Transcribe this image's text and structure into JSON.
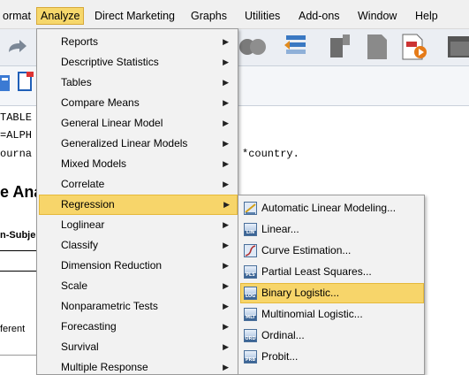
{
  "menubar": {
    "items": [
      "ormat",
      "Analyze",
      "Direct Marketing",
      "Graphs",
      "Utilities",
      "Add-ons",
      "Window",
      "Help"
    ],
    "active": "Analyze"
  },
  "syntax": {
    "line1": "TABLE",
    "line2": "=ALPH",
    "line3": "ourna",
    "line3_right": "*country.",
    "heading": "e Ana",
    "subheading": "n-Subje",
    "row_label": "ferent"
  },
  "analyze_menu": {
    "items": [
      {
        "label": "Reports"
      },
      {
        "label": "Descriptive Statistics"
      },
      {
        "label": "Tables"
      },
      {
        "label": "Compare Means"
      },
      {
        "label": "General Linear Model"
      },
      {
        "label": "Generalized Linear Models"
      },
      {
        "label": "Mixed Models"
      },
      {
        "label": "Correlate"
      },
      {
        "label": "Regression"
      },
      {
        "label": "Loglinear"
      },
      {
        "label": "Classify"
      },
      {
        "label": "Dimension Reduction"
      },
      {
        "label": "Scale"
      },
      {
        "label": "Nonparametric Tests"
      },
      {
        "label": "Forecasting"
      },
      {
        "label": "Survival"
      },
      {
        "label": "Multiple Response"
      }
    ],
    "highlighted": "Regression"
  },
  "regression_submenu": {
    "items": [
      {
        "label": "Automatic Linear Modeling...",
        "icon": "auto-linear-icon",
        "badge": ""
      },
      {
        "label": "Linear...",
        "icon": "linear-icon",
        "badge": "LIN"
      },
      {
        "label": "Curve Estimation...",
        "icon": "curve-icon",
        "badge": ""
      },
      {
        "label": "Partial Least Squares...",
        "icon": "pls-icon",
        "badge": "PLS"
      },
      {
        "label": "Binary Logistic...",
        "icon": "binary-logistic-icon",
        "badge": "LOG"
      },
      {
        "label": "Multinomial Logistic...",
        "icon": "multinomial-icon",
        "badge": "MLT"
      },
      {
        "label": "Ordinal...",
        "icon": "ordinal-icon",
        "badge": "ORD"
      },
      {
        "label": "Probit...",
        "icon": "probit-icon",
        "badge": "PRB"
      }
    ],
    "highlighted": "Binary Logistic..."
  },
  "colors": {
    "highlight": "#f7d56a",
    "menu_bg": "#f2f2f2"
  }
}
